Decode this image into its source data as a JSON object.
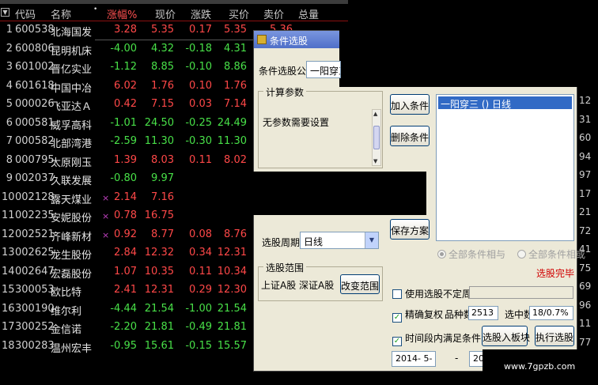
{
  "table": {
    "headers": {
      "code": "代码",
      "name": "名称",
      "pct": "涨幅%",
      "price": "现价",
      "change": "涨跌",
      "buy": "买价",
      "sell": "卖价",
      "volume": "总量"
    },
    "rows": [
      {
        "idx": "1",
        "code": "600538",
        "name": "北海国发",
        "mark": "",
        "pct": "3.28",
        "price": "5.35",
        "change": "0.17",
        "buy": "5.35",
        "sell": "5.36",
        "dir": "up"
      },
      {
        "idx": "2",
        "code": "600806",
        "name": "昆明机床",
        "mark": "",
        "pct": "-4.00",
        "price": "4.32",
        "change": "-0.18",
        "buy": "4.31",
        "sell": "",
        "dir": "down"
      },
      {
        "idx": "3",
        "code": "601002",
        "name": "晋亿实业",
        "mark": "",
        "pct": "-1.12",
        "price": "8.85",
        "change": "-0.10",
        "buy": "8.86",
        "sell": "",
        "dir": "down"
      },
      {
        "idx": "4",
        "code": "601618",
        "name": "中国中冶",
        "mark": "",
        "pct": "6.02",
        "price": "1.76",
        "change": "0.10",
        "buy": "1.76",
        "sell": "",
        "dir": "up"
      },
      {
        "idx": "5",
        "code": "000026",
        "name": "飞亚达Ａ",
        "mark": "",
        "pct": "0.42",
        "price": "7.15",
        "change": "0.03",
        "buy": "7.14",
        "sell": "",
        "dir": "up"
      },
      {
        "idx": "6",
        "code": "000581",
        "name": "威孚高科",
        "mark": "",
        "pct": "-1.01",
        "price": "24.50",
        "change": "-0.25",
        "buy": "24.49",
        "sell": "",
        "dir": "down"
      },
      {
        "idx": "7",
        "code": "000582",
        "name": "北部湾港",
        "mark": "",
        "pct": "-2.59",
        "price": "11.30",
        "change": "-0.30",
        "buy": "11.30",
        "sell": "",
        "dir": "down"
      },
      {
        "idx": "8",
        "code": "000795",
        "name": "太原刚玉",
        "mark": "",
        "pct": "1.39",
        "price": "8.03",
        "change": "0.11",
        "buy": "8.02",
        "sell": "",
        "dir": "up"
      },
      {
        "idx": "9",
        "code": "002037",
        "name": "久联发展",
        "mark": "",
        "pct": "-0.80",
        "price": "9.97",
        "change": "",
        "buy": "",
        "sell": "",
        "dir": "down"
      },
      {
        "idx": "10",
        "code": "002128",
        "name": "露天煤业",
        "mark": "×",
        "pct": "2.14",
        "price": "7.16",
        "change": "",
        "buy": "",
        "sell": "",
        "dir": "up"
      },
      {
        "idx": "11",
        "code": "002235",
        "name": "安妮股份",
        "mark": "×",
        "pct": "0.78",
        "price": "16.75",
        "change": "",
        "buy": "",
        "sell": "",
        "dir": "up"
      },
      {
        "idx": "12",
        "code": "002521",
        "name": "齐峰新材",
        "mark": "×",
        "pct": "0.92",
        "price": "8.77",
        "change": "0.08",
        "buy": "8.76",
        "sell": "",
        "dir": "up"
      },
      {
        "idx": "13",
        "code": "002625",
        "name": "龙生股份",
        "mark": "",
        "pct": "2.84",
        "price": "12.32",
        "change": "0.34",
        "buy": "12.31",
        "sell": "",
        "dir": "up"
      },
      {
        "idx": "14",
        "code": "002647",
        "name": "宏磊股份",
        "mark": "",
        "pct": "1.07",
        "price": "10.35",
        "change": "0.11",
        "buy": "10.34",
        "sell": "",
        "dir": "up"
      },
      {
        "idx": "15",
        "code": "300053",
        "name": "欧比特",
        "mark": "",
        "pct": "2.41",
        "price": "12.31",
        "change": "0.29",
        "buy": "12.30",
        "sell": "",
        "dir": "up"
      },
      {
        "idx": "16",
        "code": "300190",
        "name": "维尔利",
        "mark": "",
        "pct": "-4.44",
        "price": "21.54",
        "change": "-1.00",
        "buy": "21.54",
        "sell": "",
        "dir": "down"
      },
      {
        "idx": "17",
        "code": "300252",
        "name": "金信诺",
        "mark": "",
        "pct": "-2.20",
        "price": "21.81",
        "change": "-0.49",
        "buy": "21.81",
        "sell": "",
        "dir": "down"
      },
      {
        "idx": "18",
        "code": "300283",
        "name": "温州宏丰",
        "mark": "",
        "pct": "-0.95",
        "price": "15.61",
        "change": "-0.15",
        "buy": "15.57",
        "sell": "",
        "dir": "down"
      }
    ]
  },
  "dialog": {
    "title": "条件选股",
    "formula_label": "条件选股公式",
    "formula_value": "一阳穿三",
    "params_group": "计算参数",
    "params_text": "无参数需要设置",
    "add_condition": "加入条件",
    "delete_condition": "删除条件",
    "save_plan": "保存方案",
    "condition_list": [
      "一阳穿三  () 日线"
    ],
    "period_label": "选股周期:",
    "period_value": "日线",
    "radio_and": "全部条件相与",
    "radio_or": "全部条件相或",
    "status": "选股完毕",
    "range_group": "选股范围",
    "range_text": "上证A股 深证A股",
    "change_range": "改变范围",
    "chk_variable_period": "使用选股不定周期",
    "chk_exact_rights": "精确复权",
    "count_label": "品种数",
    "count_value": "2513",
    "selected_label": "选中数",
    "selected_value": "18/0.7%",
    "chk_time_range": "时间段内满足条件",
    "to_board": "选股入板块",
    "execute": "执行选股",
    "date_from": "2014- 5- 3",
    "date_sep": "-",
    "date_to": "201"
  },
  "right_edge": [
    "12",
    "31",
    "60",
    "94",
    "97",
    "17",
    "21",
    "72",
    "41",
    "75",
    "69",
    "96",
    "11",
    "77"
  ],
  "watermark": "www.7gpzb.com",
  "colors": {
    "up": "#ff4848",
    "down": "#48e048",
    "selection": "#316ac5",
    "status": "#d00000"
  }
}
